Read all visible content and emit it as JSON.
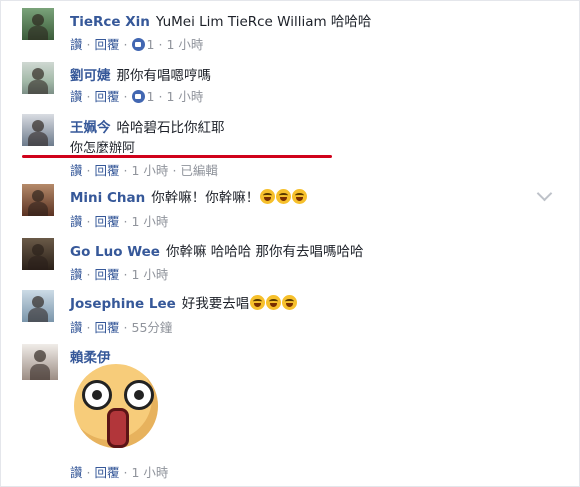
{
  "actions": {
    "like": "讚",
    "reply": "回覆",
    "dot": "·"
  },
  "comments": [
    {
      "name": "TieRce Xin",
      "text": "YuMei Lim TieRce William 哈哈哈",
      "likes": "1",
      "time": "1 小時"
    },
    {
      "name": "劉可婕",
      "text": "那你有唱嗯哼嗎",
      "likes": "1",
      "time": "1 小時"
    },
    {
      "name": "王姵今",
      "text": "哈哈碧石比你紅耶",
      "text2": "你怎麼辦阿",
      "time": "1 小時",
      "edited": "已編輯"
    },
    {
      "name": "Mini Chan",
      "text": "你幹嘛！你幹嘛！",
      "time": "1 小時"
    },
    {
      "name": "Go Luo Wee",
      "text": "你幹嘛 哈哈哈 那你有去唱嗎哈哈",
      "time": "1 小時"
    },
    {
      "name": "Josephine Lee",
      "text": "好我要去唱",
      "time": "55分鐘"
    },
    {
      "name": "賴柔伊",
      "time": "1 小時"
    }
  ],
  "colors": {
    "name": "#365899",
    "meta": "#90949c",
    "like_icon": "#4267b2",
    "underline": "#d0021b"
  },
  "icons": {
    "like": "thumbs-up-icon",
    "emoji": "laughing-emoji-icon",
    "options": "chevron-down-icon",
    "sticker": "shocked-face-sticker"
  }
}
